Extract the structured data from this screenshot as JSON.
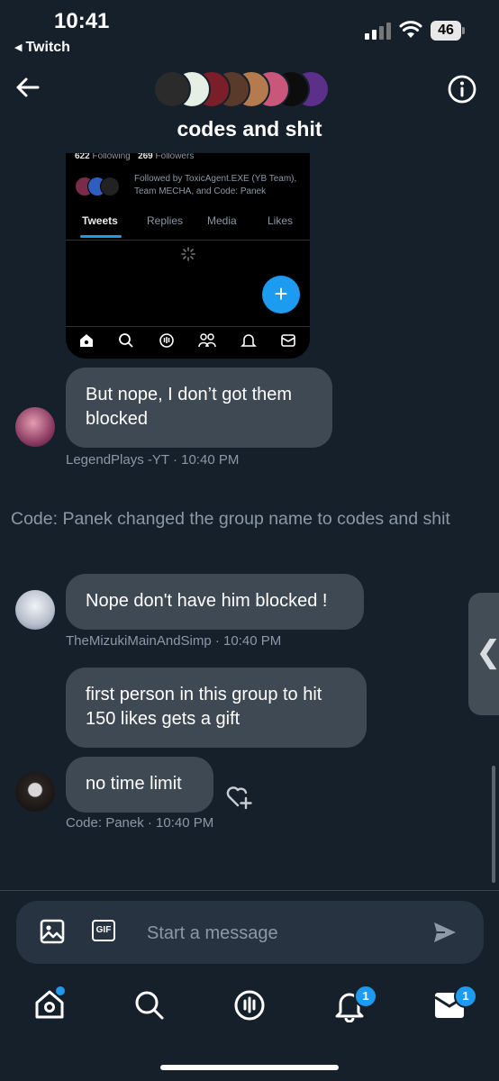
{
  "status_bar": {
    "time": "10:41",
    "back_app": "Twitch",
    "battery": "46"
  },
  "header": {
    "title": "codes and shit",
    "avatar_colors": [
      "#2b2b2b",
      "#e6efe4",
      "#7a1e2a",
      "#5a3a2a",
      "#b57b4f",
      "#c8577b",
      "#0d0d0d",
      "#5b2f8a"
    ]
  },
  "embedded_screenshot": {
    "following_count": "622",
    "following_label": "Following",
    "followers_count": "269",
    "followers_label": "Followers",
    "followed_by": "Followed by ToxicAgent.EXE (YB Team), Team MECHA, and Code: Panek",
    "tabs": [
      "Tweets",
      "Replies",
      "Media",
      "Likes"
    ],
    "fab_label": "+"
  },
  "messages": [
    {
      "text": "But nope, I don’t got them blocked",
      "meta": "LegendPlays -YT · 10:40 PM",
      "avatar_color": "#a04b6e"
    },
    {
      "text": "Nope don't have him blocked !",
      "meta": "TheMizukiMainAndSimp · 10:40 PM",
      "avatar_color": "#c9ced6"
    },
    {
      "text": "first person in this group to hit 150 likes gets a gift"
    },
    {
      "text": "no time limit",
      "meta": "Code: Panek · 10:40 PM",
      "avatar_color": "#2a2522"
    }
  ],
  "system_message": "Code: Panek changed the group name to codes and shit",
  "composer": {
    "placeholder": "Start a message",
    "gif_label": "GIF"
  },
  "side_tab_glyph": "❮",
  "bottom_nav": {
    "notifications_badge": "1",
    "messages_badge": "1"
  }
}
